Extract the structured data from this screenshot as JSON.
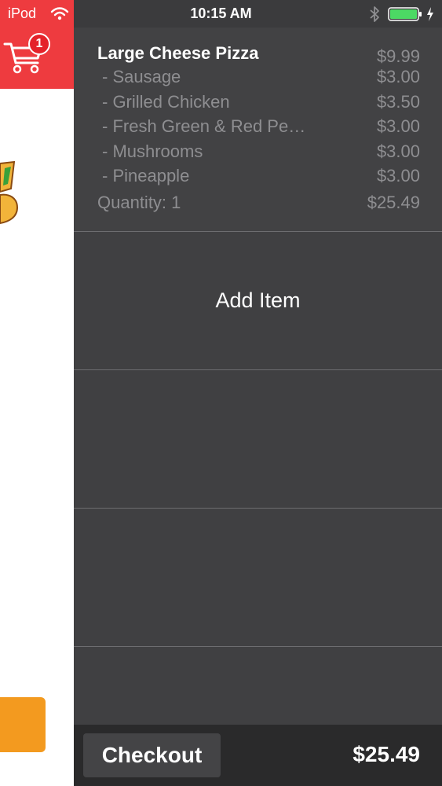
{
  "status_bar": {
    "carrier": "iPod",
    "time": "10:15 AM"
  },
  "background_app": {
    "cart_badge_count": "1",
    "header_color": "#ee3b3f",
    "button_color": "#f39a1f"
  },
  "cart": {
    "item": {
      "title": "Large Cheese Pizza",
      "price": "$9.99",
      "toppings": [
        {
          "name": "- Sausage",
          "price": "$3.00"
        },
        {
          "name": "- Grilled Chicken",
          "price": "$3.50"
        },
        {
          "name": "- Fresh Green & Red Pe…",
          "price": "$3.00"
        },
        {
          "name": "- Mushrooms",
          "price": "$3.00"
        },
        {
          "name": "- Pineapple",
          "price": "$3.00"
        }
      ],
      "quantity_label": "Quantity: 1",
      "total": "$25.49"
    },
    "add_item_label": "Add Item",
    "checkout_label": "Checkout",
    "checkout_total": "$25.49"
  }
}
